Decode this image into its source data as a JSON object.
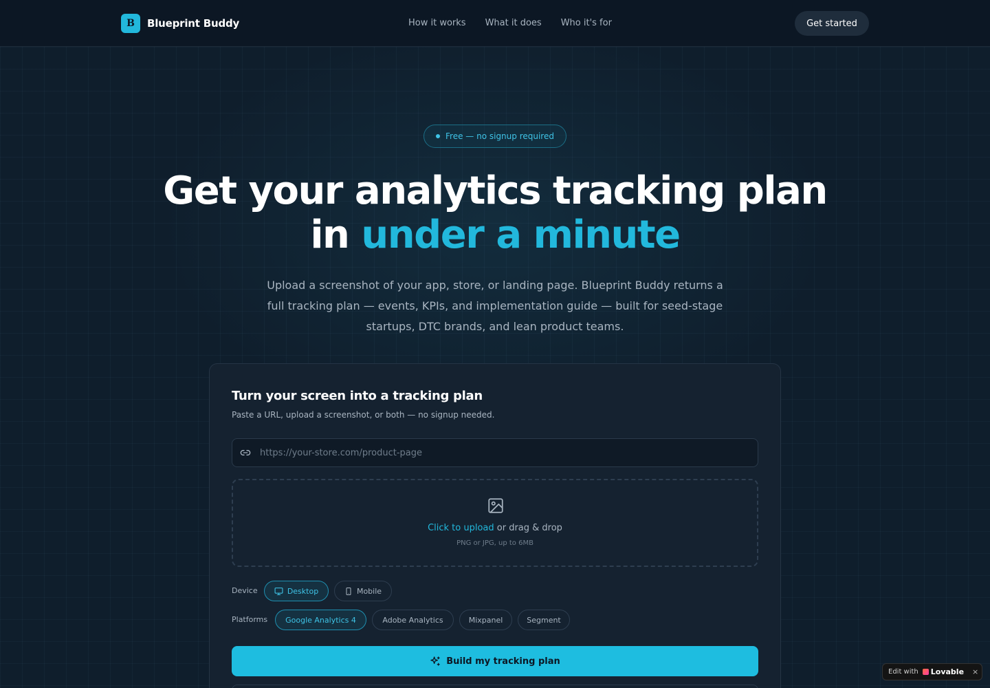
{
  "nav": {
    "brand_initial": "B",
    "brand_name": "Blueprint Buddy",
    "links": [
      "How it works",
      "What it does",
      "Who it's for"
    ],
    "cta": "Get started"
  },
  "hero": {
    "badge": "Free — no signup required",
    "title_main": "Get your analytics tracking plan in ",
    "title_accent": "under a minute",
    "subtitle": "Upload a screenshot of your app, store, or landing page. Blueprint Buddy returns a full tracking plan — events, KPIs, and implementation guide — built for seed-stage startups, DTC brands, and lean product teams."
  },
  "card": {
    "title": "Turn your screen into a tracking plan",
    "subtitle": "Paste a URL, upload a screenshot, or both — no signup needed.",
    "url_placeholder": "https://your-store.com/product-page",
    "upload_link": "Click to upload",
    "upload_rest": " or drag & drop",
    "upload_hint": "PNG or JPG, up to 6MB",
    "device_label": "Device",
    "devices": [
      {
        "label": "Desktop",
        "icon": "monitor-icon",
        "selected": true
      },
      {
        "label": "Mobile",
        "icon": "smartphone-icon",
        "selected": false
      }
    ],
    "platforms_label": "Platforms",
    "platforms": [
      {
        "label": "Google Analytics 4",
        "selected": true
      },
      {
        "label": "Adobe Analytics",
        "selected": false
      },
      {
        "label": "Mixpanel",
        "selected": false
      },
      {
        "label": "Segment",
        "selected": false
      }
    ],
    "submit": "Build my tracking plan"
  },
  "badge": {
    "prefix": "Edit with",
    "brand": "Lovable",
    "close": "×"
  },
  "colors": {
    "accent": "#22b8dc",
    "background": "#0f1e2c",
    "card": "#152230"
  }
}
